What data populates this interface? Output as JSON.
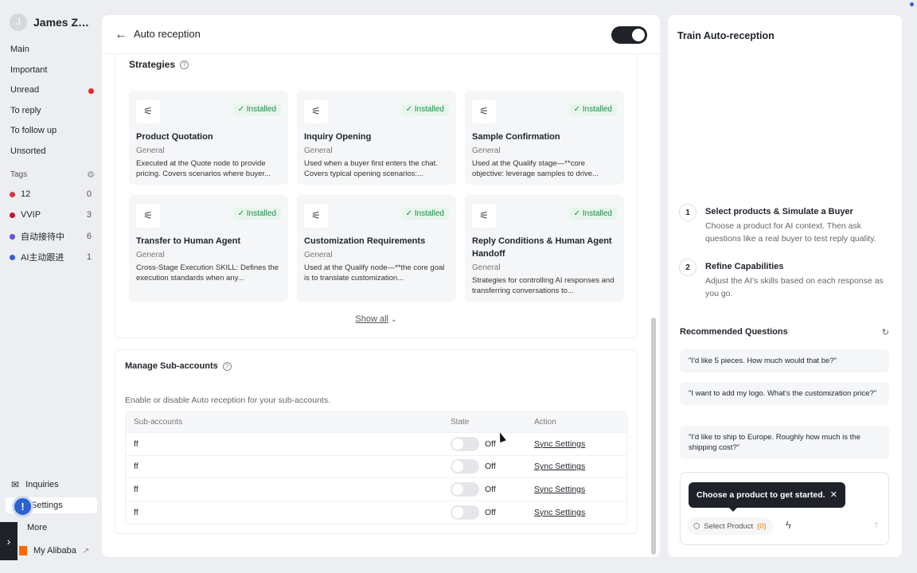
{
  "sidebar": {
    "user_initial": "J",
    "user_name": "James Zha...",
    "nav": [
      "Main",
      "Important",
      "Unread",
      "To reply",
      "To follow up",
      "Unsorted"
    ],
    "tags_label": "Tags",
    "tags": [
      {
        "label": "12",
        "count": "0",
        "color": "#d9363e"
      },
      {
        "label": "VVIP",
        "count": "3",
        "color": "#c8102e"
      },
      {
        "label": "自动接待中",
        "count": "6",
        "color": "#6b4fd8"
      },
      {
        "label": "AI主动跟进",
        "count": "1",
        "color": "#3b5bdb"
      }
    ],
    "inquiries_label": "Inquiries",
    "settings_label": "Settings",
    "more_label": "More",
    "alibaba_label": "My Alibaba"
  },
  "main": {
    "title": "Auto reception",
    "strategies_title": "Strategies",
    "cards": [
      {
        "name": "Product Quotation",
        "category": "General",
        "status": "Installed",
        "desc": "Executed at the Quote node to provide pricing. Covers scenarios where buyer..."
      },
      {
        "name": "Inquiry Opening",
        "category": "General",
        "status": "Installed",
        "desc": "Used when a buyer first enters the chat. Covers typical opening scenarios:..."
      },
      {
        "name": "Sample Confirmation",
        "category": "General",
        "status": "Installed",
        "desc": "Used at the Qualify stage—**core objective: leverage samples to drive..."
      },
      {
        "name": "Transfer to Human Agent",
        "category": "General",
        "status": "Installed",
        "desc": "Cross-Stage Execution SKILL: Defines the execution standards when any..."
      },
      {
        "name": "Customization Requirements",
        "category": "General",
        "status": "Installed",
        "desc": "Used at the Qualify node—**the core goal is to translate customization..."
      },
      {
        "name": "Reply Conditions & Human Agent Handoff",
        "category": "General",
        "status": "Installed",
        "desc": "Strategies for controlling AI responses and transferring conversations to..."
      }
    ],
    "show_all": "Show all",
    "sub_accounts": {
      "title": "Manage Sub-accounts",
      "desc": "Enable or disable Auto reception for your sub-accounts.",
      "headers": [
        "Sub-accounts",
        "State",
        "Action"
      ],
      "rows": [
        {
          "name": "ff",
          "state": "Off",
          "action": "Sync Settings"
        },
        {
          "name": "ff",
          "state": "Off",
          "action": "Sync Settings"
        },
        {
          "name": "ff",
          "state": "Off",
          "action": "Sync Settings"
        },
        {
          "name": "ff",
          "state": "Off",
          "action": "Sync Settings"
        }
      ]
    }
  },
  "right": {
    "title": "Train Auto-reception",
    "steps": [
      {
        "num": "1",
        "title": "Select products & Simulate a Buyer",
        "desc": "Choose a product for AI context. Then ask questions like a real buyer to test reply quality."
      },
      {
        "num": "2",
        "title": "Refine Capabilities",
        "desc": "Adjust the AI's skills based on each response as you go."
      }
    ],
    "rec_title": "Recommended Questions",
    "questions": [
      "\"I'd like 5 pieces. How much would that be?\"",
      "\"I want to add my logo. What's the customization price?\"",
      "\"I'd like to ship to Europe. Roughly how much is the shipping cost?\""
    ],
    "tooltip": "Choose a product to get started.",
    "select_product": "Select Product",
    "product_count": "(0)"
  }
}
